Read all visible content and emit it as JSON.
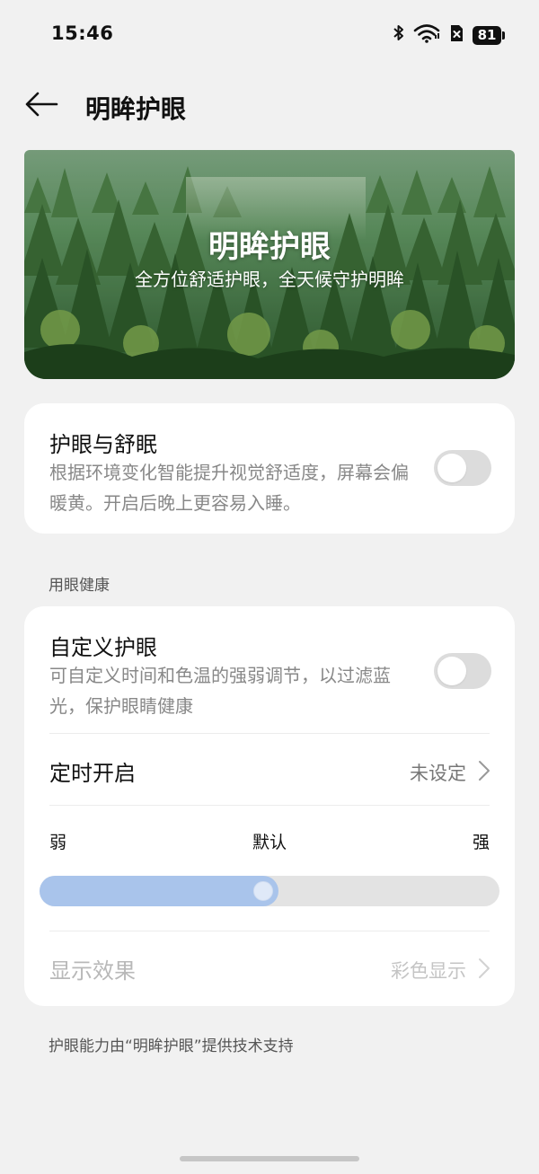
{
  "status_bar": {
    "time": "15:46",
    "battery_level": "81",
    "icons": [
      "bluetooth-icon",
      "wifi-icon",
      "no-sim-icon",
      "battery-icon"
    ]
  },
  "header": {
    "title": "明眸护眼",
    "back_icon": "arrow-left-icon"
  },
  "banner": {
    "title": "明眸护眼",
    "subtitle": "全方位舒适护眼，全天候守护明眸"
  },
  "eye_sleep": {
    "title": "护眼与舒眠",
    "description": "根据环境变化智能提升视觉舒适度，屏幕会偏暖黄。开启后晚上更容易入睡。",
    "enabled": false
  },
  "section_label": "用眼健康",
  "custom_eye_care": {
    "title": "自定义护眼",
    "description": "可自定义时间和色温的强弱调节，以过滤蓝光，保护眼睛健康",
    "enabled": false
  },
  "schedule": {
    "label": "定时开启",
    "value": "未设定"
  },
  "intensity": {
    "min_label": "弱",
    "mid_label": "默认",
    "max_label": "强",
    "level_fraction": 0.52
  },
  "display_effect": {
    "label": "显示效果",
    "value": "彩色显示",
    "disabled": true
  },
  "footer_note": "护眼能力由“明眸护眼”提供技术支持",
  "colors": {
    "accent_fill": "#a9c4eb",
    "background": "#f1f1f1",
    "card": "#ffffff"
  }
}
